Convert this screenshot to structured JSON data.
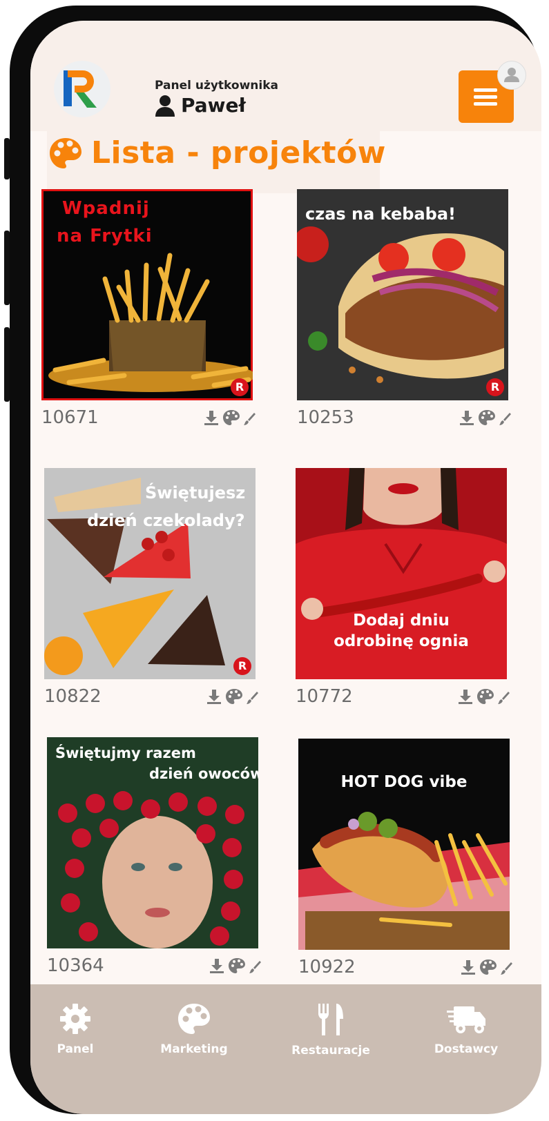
{
  "header": {
    "panel_label": "Panel użytkownika",
    "user_name": "Paweł"
  },
  "page": {
    "title": "Lista - projektów"
  },
  "projects": [
    {
      "id": "10671",
      "caption": "Wpadnij na Frytki"
    },
    {
      "id": "10253",
      "caption": "czas na kebaba!"
    },
    {
      "id": "10822",
      "caption": "Świętujesz dzień czekolady?"
    },
    {
      "id": "10772",
      "caption": "Dodaj dniu odrobinę ognia"
    },
    {
      "id": "10364",
      "caption": "Świętujmy razem dzień owoców"
    },
    {
      "id": "10922",
      "caption": "HOT DOG vibe"
    }
  ],
  "nav": {
    "items": [
      {
        "label": "Panel",
        "icon": "gear-icon"
      },
      {
        "label": "Marketing",
        "icon": "palette-icon"
      },
      {
        "label": "Restauracje",
        "icon": "fork-knife-icon"
      },
      {
        "label": "Dostawcy",
        "icon": "delivery-truck-icon"
      }
    ]
  },
  "colors": {
    "accent": "#f7830b",
    "nav_background": "#cbbdb3",
    "screen_background": "#fdf7f4"
  }
}
